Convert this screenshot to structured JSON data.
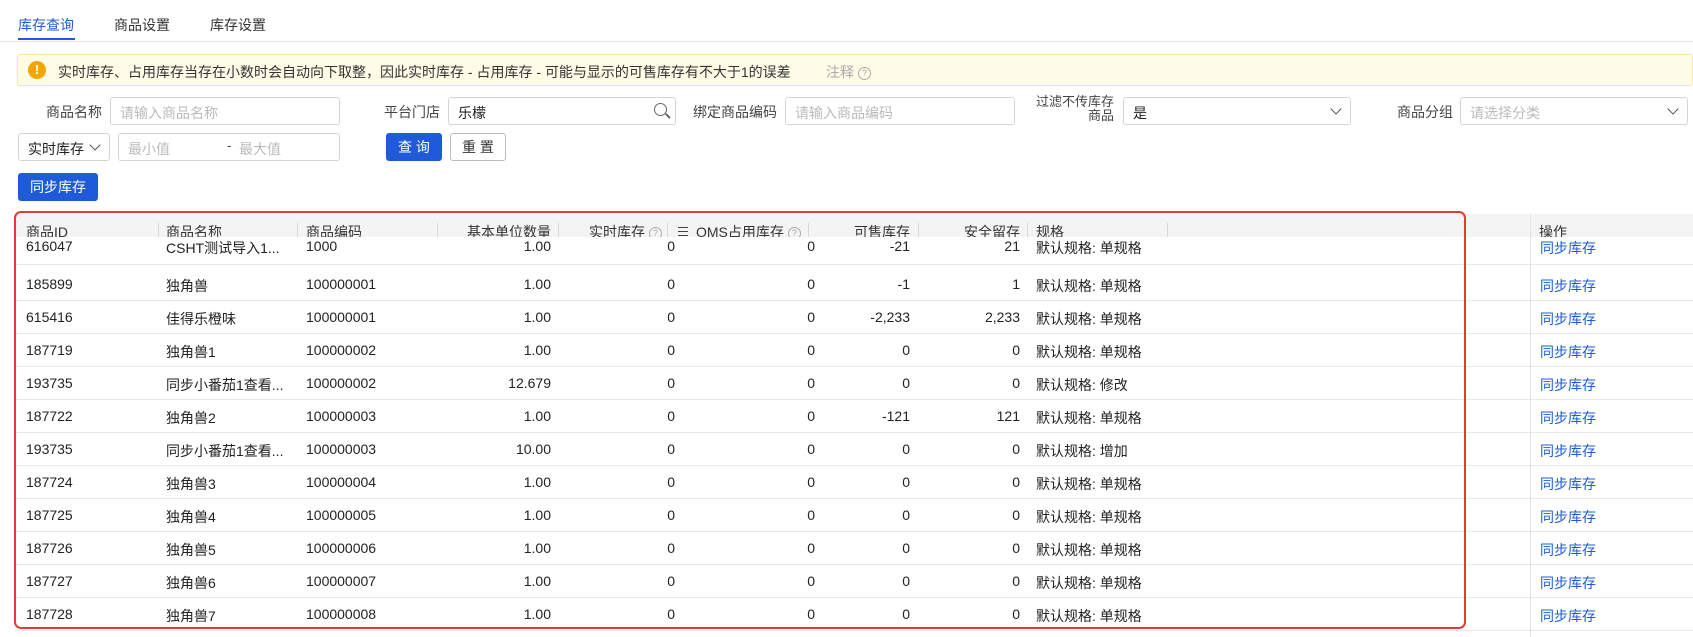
{
  "tabs": [
    {
      "label": "库存查询",
      "active": true
    },
    {
      "label": "商品设置",
      "active": false
    },
    {
      "label": "库存设置",
      "active": false
    }
  ],
  "notice": {
    "text": "实时库存、占用库存当存在小数时会自动向下取整，因此实时库存 - 占用库存 - 可能与显示的可售库存有不大于1的误差",
    "note_label": "注释",
    "icon": "warning-icon",
    "accent": "#f3a600"
  },
  "filters": {
    "product_name_label": "商品名称",
    "product_name_placeholder": "请输入商品名称",
    "store_label": "平台门店",
    "store_value": "乐檬",
    "bind_code_label": "绑定商品编码",
    "bind_code_placeholder": "请输入商品编码",
    "filter_label_line1": "过滤不传库存",
    "filter_label_line2": "商品",
    "filter_value": "是",
    "group_label": "商品分组",
    "group_placeholder": "请选择分类",
    "stock_type_value": "实时库存",
    "min_placeholder": "最小值",
    "range_sep": "-",
    "max_placeholder": "最大值"
  },
  "buttons": {
    "query": "查 询",
    "reset": "重 置",
    "sync_all": "同步库存"
  },
  "table": {
    "columns": [
      "商品ID",
      "商品名称",
      "商品编码",
      "基本单位数量",
      "实时库存",
      "OMS占用库存",
      "可售库存",
      "安全留存",
      "规格",
      "操作"
    ],
    "action_label": "同步库存",
    "rows": [
      {
        "id": "616047",
        "name": "CSHT测试导入1...",
        "code": "1000",
        "qty": "1.00",
        "realtime": "0",
        "oms": "0",
        "sellable": "-21",
        "safety": "21",
        "spec": "默认规格: 单规格"
      },
      {
        "id": "185899",
        "name": "独角兽",
        "code": "100000001",
        "qty": "1.00",
        "realtime": "0",
        "oms": "0",
        "sellable": "-1",
        "safety": "1",
        "spec": "默认规格: 单规格"
      },
      {
        "id": "615416",
        "name": "佳得乐橙味",
        "code": "100000001",
        "qty": "1.00",
        "realtime": "0",
        "oms": "0",
        "sellable": "-2,233",
        "safety": "2,233",
        "spec": "默认规格: 单规格"
      },
      {
        "id": "187719",
        "name": "独角兽1",
        "code": "100000002",
        "qty": "1.00",
        "realtime": "0",
        "oms": "0",
        "sellable": "0",
        "safety": "0",
        "spec": "默认规格: 单规格"
      },
      {
        "id": "193735",
        "name": "同步小番茄1查看...",
        "code": "100000002",
        "qty": "12.679",
        "realtime": "0",
        "oms": "0",
        "sellable": "0",
        "safety": "0",
        "spec": "默认规格: 修改"
      },
      {
        "id": "187722",
        "name": "独角兽2",
        "code": "100000003",
        "qty": "1.00",
        "realtime": "0",
        "oms": "0",
        "sellable": "-121",
        "safety": "121",
        "spec": "默认规格: 单规格"
      },
      {
        "id": "193735",
        "name": "同步小番茄1查看...",
        "code": "100000003",
        "qty": "10.00",
        "realtime": "0",
        "oms": "0",
        "sellable": "0",
        "safety": "0",
        "spec": "默认规格: 增加"
      },
      {
        "id": "187724",
        "name": "独角兽3",
        "code": "100000004",
        "qty": "1.00",
        "realtime": "0",
        "oms": "0",
        "sellable": "0",
        "safety": "0",
        "spec": "默认规格: 单规格"
      },
      {
        "id": "187725",
        "name": "独角兽4",
        "code": "100000005",
        "qty": "1.00",
        "realtime": "0",
        "oms": "0",
        "sellable": "0",
        "safety": "0",
        "spec": "默认规格: 单规格"
      },
      {
        "id": "187726",
        "name": "独角兽5",
        "code": "100000006",
        "qty": "1.00",
        "realtime": "0",
        "oms": "0",
        "sellable": "0",
        "safety": "0",
        "spec": "默认规格: 单规格"
      },
      {
        "id": "187727",
        "name": "独角兽6",
        "code": "100000007",
        "qty": "1.00",
        "realtime": "0",
        "oms": "0",
        "sellable": "0",
        "safety": "0",
        "spec": "默认规格: 单规格"
      },
      {
        "id": "187728",
        "name": "独角兽7",
        "code": "100000008",
        "qty": "1.00",
        "realtime": "0",
        "oms": "0",
        "sellable": "0",
        "safety": "0",
        "spec": "默认规格: 单规格"
      }
    ]
  },
  "colors": {
    "primary": "#1f5bd8",
    "highlight_box": "#e53935"
  }
}
